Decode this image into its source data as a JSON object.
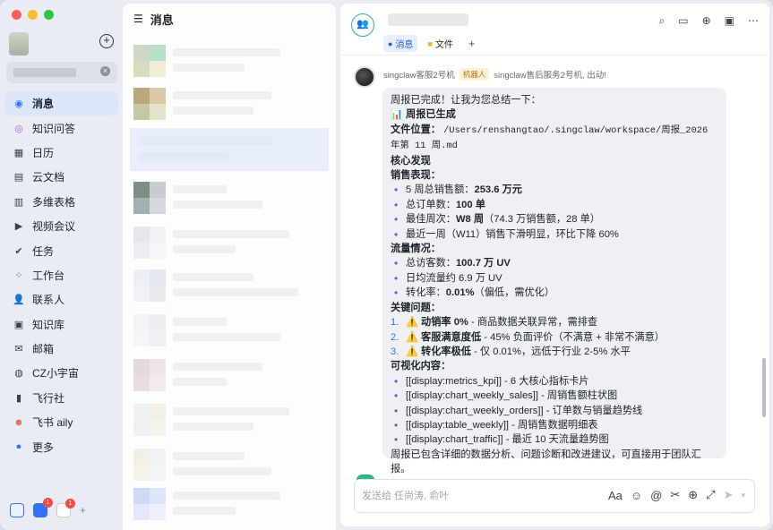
{
  "sidebar": {
    "items": [
      {
        "label": "消息",
        "icon": "message-icon"
      },
      {
        "label": "知识问答",
        "icon": "ai-answer-icon"
      },
      {
        "label": "日历",
        "icon": "calendar-icon"
      },
      {
        "label": "云文档",
        "icon": "cloud-doc-icon"
      },
      {
        "label": "多维表格",
        "icon": "base-table-icon"
      },
      {
        "label": "视频会议",
        "icon": "video-meeting-icon"
      },
      {
        "label": "任务",
        "icon": "task-check-icon"
      },
      {
        "label": "工作台",
        "icon": "workplace-grid-icon"
      },
      {
        "label": "联系人",
        "icon": "contacts-icon"
      },
      {
        "label": "知识库",
        "icon": "wiki-icon"
      },
      {
        "label": "邮箱",
        "icon": "mail-icon"
      },
      {
        "label": "CZ小宇宙",
        "icon": "planet-icon"
      },
      {
        "label": "飞行社",
        "icon": "bookmark-icon"
      },
      {
        "label": "飞书 aily",
        "icon": "aily-avatar-icon"
      },
      {
        "label": "更多",
        "icon": "more-icon"
      }
    ],
    "bottom_badges": [
      "1",
      "1"
    ]
  },
  "midpanel": {
    "title": "消息"
  },
  "chat": {
    "tabs": [
      {
        "label": "消息",
        "icon": "chat-bubble-icon"
      },
      {
        "label": "文件",
        "icon": "folder-icon"
      }
    ],
    "message": {
      "sender": "singclaw客服2号机",
      "robot_tag": "机器人",
      "meta": "singclaw售后服务2号机, 出动!",
      "intro": "周报已完成！让我为您总结一下：",
      "generated_title": "📊 周报已生成",
      "file_label": "文件位置：",
      "file_path": "/Users/renshangtao/.singclaw/workspace/周报_2026 年第 11 周.md",
      "core_title": "核心发现",
      "sales_title": "销售表现：",
      "sales": [
        {
          "pre": "5 周总销售额：",
          "bold": "253.6 万元",
          "post": ""
        },
        {
          "pre": "总订单数：",
          "bold": "100 单",
          "post": ""
        },
        {
          "pre": "最佳周次：",
          "bold": "W8 周",
          "post": "（74.3 万销售额，28 单）"
        },
        {
          "pre": "最近一周（W11）销售下滑明显，环比下降 60%",
          "bold": "",
          "post": ""
        }
      ],
      "traffic_title": "流量情况：",
      "traffic": [
        {
          "pre": "总访客数：",
          "bold": "100.7 万 UV",
          "post": ""
        },
        {
          "pre": "日均流量约 6.9 万 UV",
          "bold": "",
          "post": ""
        },
        {
          "pre": "转化率：",
          "bold": "0.01%",
          "post": "（偏低，需优化）"
        }
      ],
      "issues_title": "关键问题：",
      "issues": [
        {
          "num": "1.",
          "bold": "⚠️ 动销率 0%",
          "post": " - 商品数据关联异常，需排查"
        },
        {
          "num": "2.",
          "bold": "⚠️ 客服满意度低",
          "post": " - 45% 负面评价（不满意 + 非常不满意）"
        },
        {
          "num": "3.",
          "bold": "⚠️ 转化率极低",
          "post": " - 仅 0.01%，远低于行业 2-5% 水平"
        }
      ],
      "visual_title": "可视化内容：",
      "visual": [
        "[[display:metrics_kpi]] - 6 大核心指标卡片",
        "[[display:chart_weekly_sales]] - 周销售额柱状图",
        "[[display:chart_weekly_orders]] - 订单数与销量趋势线",
        "[[display:table_weekly]] - 周销售数据明细表",
        "[[display:chart_traffic]] - 最近 10 天流量趋势图"
      ],
      "outro": "周报已包含详细的数据分析、问题诊断和改进建议，可直接用于团队汇报。"
    },
    "composer_placeholder": "发送给 任尚涛, 俞叶"
  }
}
